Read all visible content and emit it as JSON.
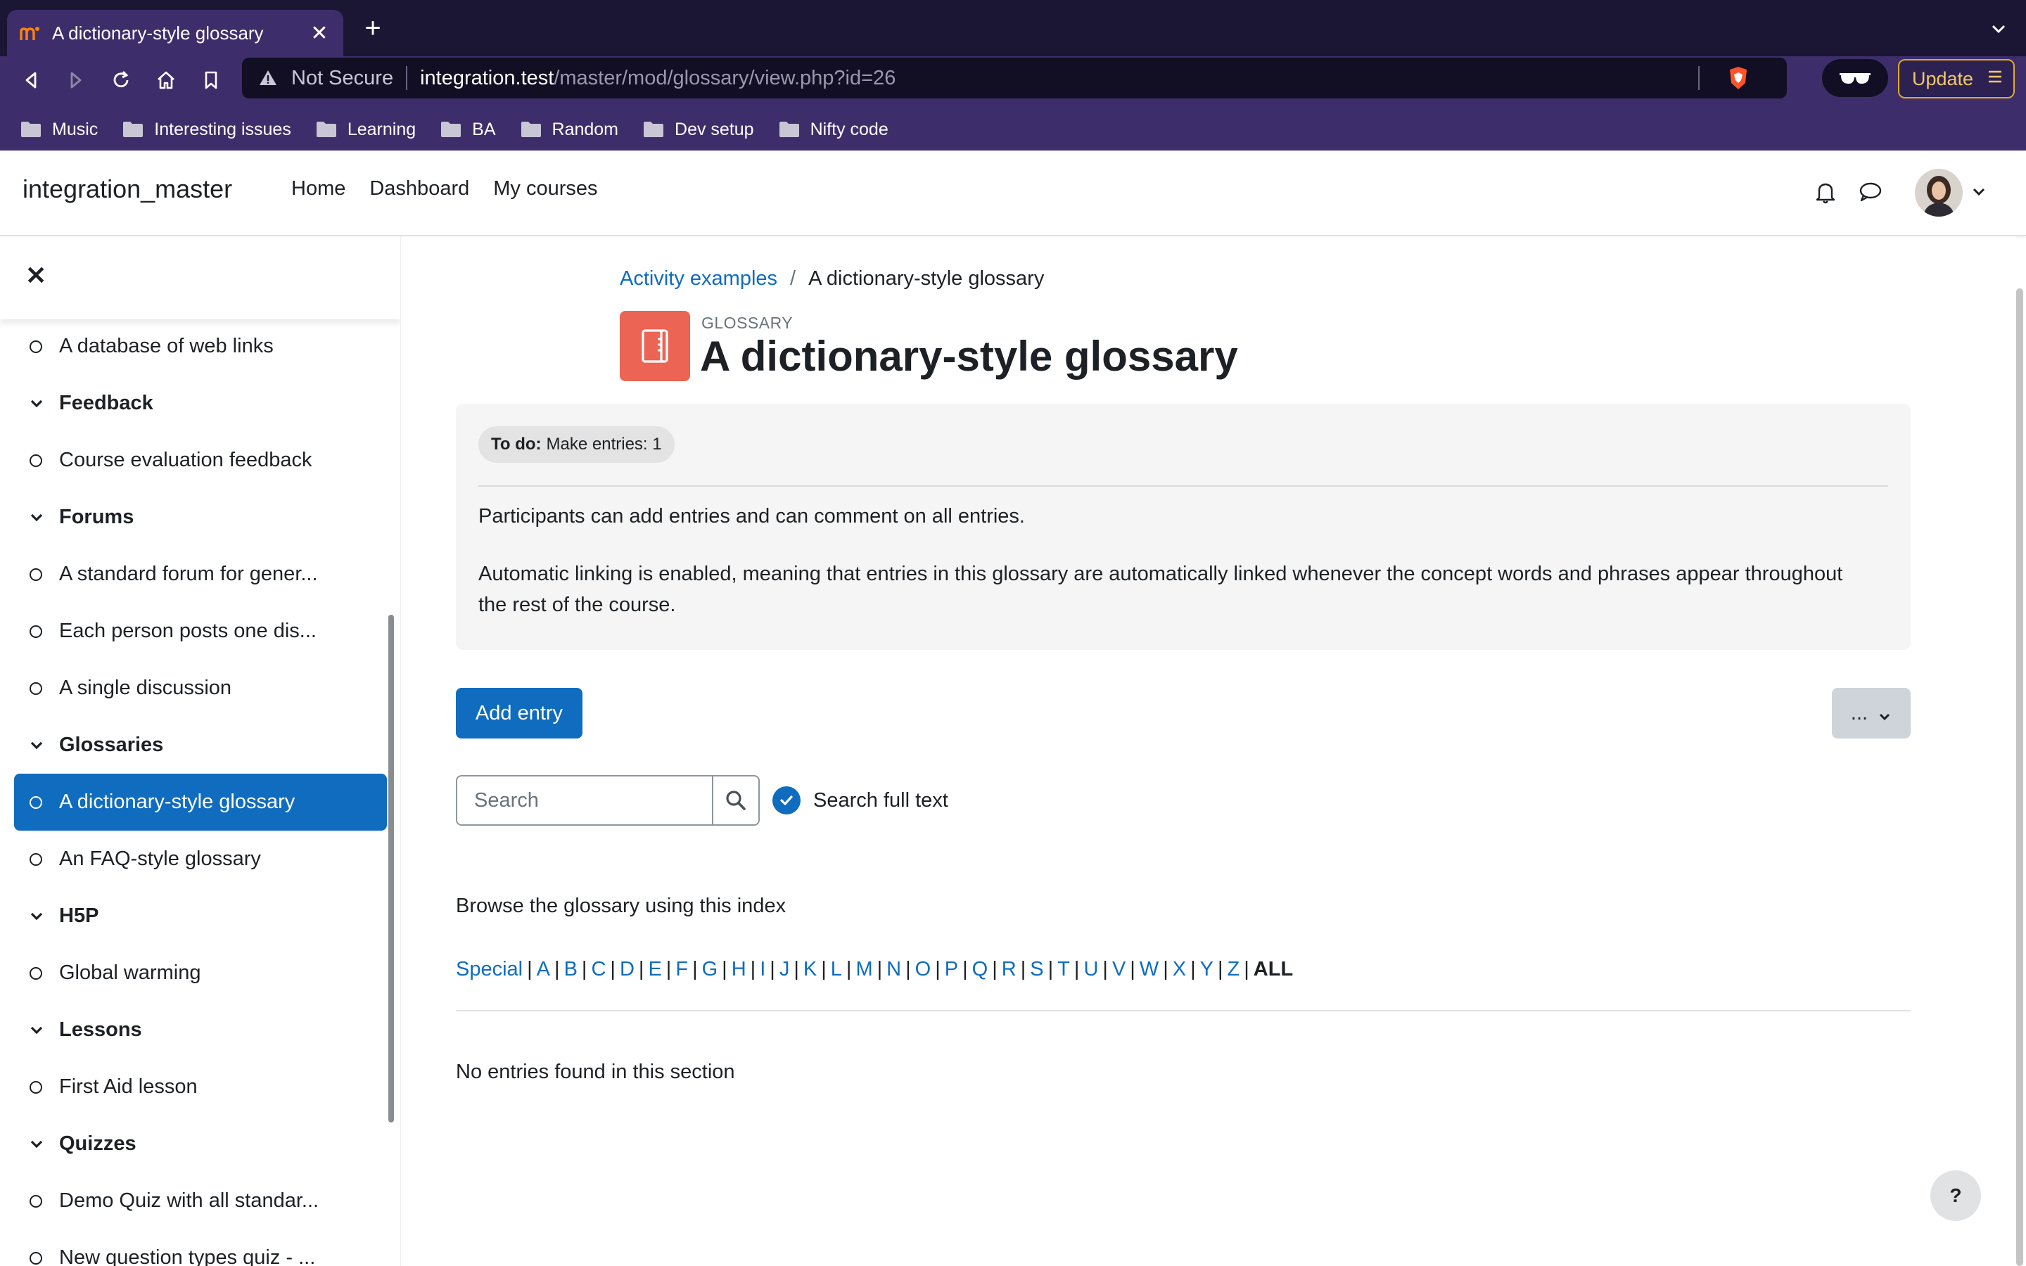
{
  "browser": {
    "tab_title": "A dictionary-style glossary",
    "tab_close": "✕",
    "new_tab": "+",
    "url_security": "Not Secure",
    "url_host": "integration.test",
    "url_path": "/master/mod/glossary/view.php?id=26",
    "update_label": "Update",
    "bookmarks": [
      "Music",
      "Interesting issues",
      "Learning",
      "BA",
      "Random",
      "Dev setup",
      "Nifty code"
    ]
  },
  "header": {
    "site_name": "integration_master",
    "nav": [
      "Home",
      "Dashboard",
      "My courses"
    ]
  },
  "drawer": {
    "close_label": "✕",
    "items": [
      {
        "type": "activity",
        "label": "A database of web links"
      },
      {
        "type": "section",
        "label": "Feedback"
      },
      {
        "type": "activity",
        "label": "Course evaluation feedback"
      },
      {
        "type": "section",
        "label": "Forums"
      },
      {
        "type": "activity",
        "label": "A standard forum for gener..."
      },
      {
        "type": "activity",
        "label": "Each person posts one dis..."
      },
      {
        "type": "activity",
        "label": "A single discussion"
      },
      {
        "type": "section",
        "label": "Glossaries"
      },
      {
        "type": "activity",
        "label": "A dictionary-style glossary",
        "active": true
      },
      {
        "type": "activity",
        "label": "An FAQ-style glossary"
      },
      {
        "type": "section",
        "label": "H5P"
      },
      {
        "type": "activity",
        "label": "Global warming"
      },
      {
        "type": "section",
        "label": "Lessons"
      },
      {
        "type": "activity",
        "label": "First Aid lesson"
      },
      {
        "type": "section",
        "label": "Quizzes"
      },
      {
        "type": "activity",
        "label": "Demo Quiz with all standar..."
      },
      {
        "type": "activity",
        "label": "New question types quiz - ..."
      }
    ]
  },
  "main": {
    "breadcrumb": {
      "parent": "Activity examples",
      "separator": "/",
      "current": "A dictionary-style glossary"
    },
    "activity_type": "GLOSSARY",
    "title": "A dictionary-style glossary",
    "todo": {
      "label": "To do:",
      "text": "Make entries: 1"
    },
    "intro_p1": "Participants can add entries and can comment on all entries.",
    "intro_p2": "Automatic linking is enabled, meaning that entries in this glossary are automatically linked whenever the concept words and phrases appear throughout the rest of the course.",
    "add_entry_label": "Add entry",
    "more_label": "...",
    "search": {
      "placeholder": "Search",
      "value": "",
      "fulltext_label": "Search full text",
      "fulltext_checked": true
    },
    "browse_title": "Browse the glossary using this index",
    "alphabet": [
      "Special",
      "A",
      "B",
      "C",
      "D",
      "E",
      "F",
      "G",
      "H",
      "I",
      "J",
      "K",
      "L",
      "M",
      "N",
      "O",
      "P",
      "Q",
      "R",
      "S",
      "T",
      "U",
      "V",
      "W",
      "X",
      "Y",
      "Z"
    ],
    "alphabet_all": "ALL",
    "no_entries": "No entries found in this section",
    "help_label": "?"
  },
  "colors": {
    "primary": "#0f6cbf",
    "glossary_icon_bg": "#eb6454",
    "browser_frame": "#3d2e6b"
  }
}
